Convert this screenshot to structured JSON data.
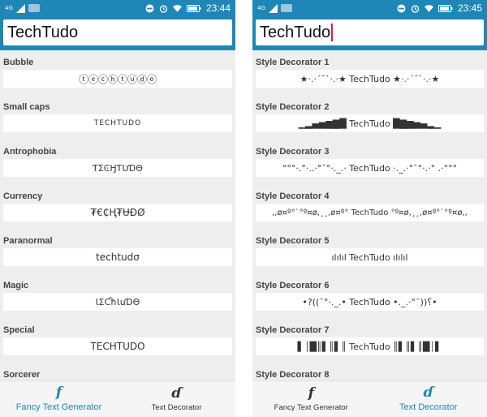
{
  "colors": {
    "accent": "#1f86b8",
    "caret": "#d81b60"
  },
  "left": {
    "status": {
      "network": "4G",
      "time": "23:44"
    },
    "input_value": "TechTudo",
    "items": [
      {
        "title": "Bubble",
        "value": "ⓣⓔⓒⓗⓣⓤⓓⓞ"
      },
      {
        "title": "Small caps",
        "value": "TECHTUDO"
      },
      {
        "title": "Antrophobia",
        "value": "ƬΣϾӇƬƲƊΘ"
      },
      {
        "title": "Currency",
        "value": "₮€₵Ⱨ₮ɄĐØ"
      },
      {
        "title": "Paranormal",
        "value": "techtudσ"
      },
      {
        "title": "Magic",
        "value": "ƖΣƇħƖuƊΘ"
      },
      {
        "title": "Special",
        "value": "TECHTUDO"
      },
      {
        "title": "Sorcerer",
        "value": ""
      }
    ],
    "nav": [
      {
        "icon": "f",
        "label": "Fancy Text Generator"
      },
      {
        "icon": "ɗ",
        "label": "Text Decorator"
      }
    ]
  },
  "right": {
    "status": {
      "network": "4G",
      "time": "23:45"
    },
    "input_value": "TechTudo",
    "items": [
      {
        "title": "Style Decorator 1",
        "value": "★·.·´¯`·.·★ TechTudo ★·.·´¯`·.·★"
      },
      {
        "title": "Style Decorator 2",
        "value": "▁▂▄▅▆▇█ TechTudo █▇▆▅▄▂▁"
      },
      {
        "title": "Style Decorator 3",
        "value": "°°°·.°·..·°¯°·._.· TechTudo ·._.·°¯°·.·° .·°°°"
      },
      {
        "title": "Style Decorator 4",
        "value": ",,ø¤º°`°º¤ø,¸¸,ø¤º° TechTudo °º¤ø,¸¸,ø¤º°`°º¤ø,,"
      },
      {
        "title": "Style Decorator 5",
        "value": "ılılıl TechTudo ılılıl"
      },
      {
        "title": "Style Decorator 6",
        "value": "•?((¯°·._.• TechTudo •._.·°¯))؟•"
      },
      {
        "title": "Style Decorator 7",
        "value": "▌│█║▌║▌║ TechTudo ║▌║▌║█│▌"
      },
      {
        "title": "Style Decorator 8",
        "value": ""
      }
    ],
    "nav": [
      {
        "icon": "f",
        "label": "Fancy Text Generator"
      },
      {
        "icon": "ɗ",
        "label": "Text Decorator"
      }
    ]
  }
}
